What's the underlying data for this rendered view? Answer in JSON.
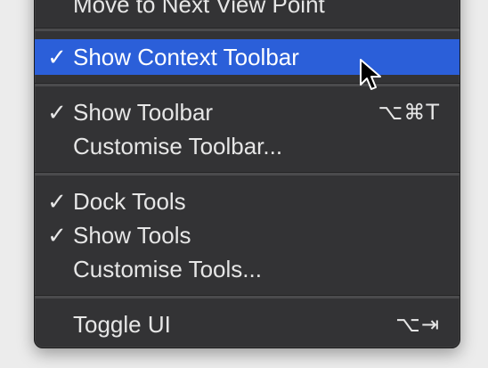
{
  "menu": {
    "items": [
      {
        "label": "Move to Next View Point",
        "checked": false,
        "shortcut": ""
      },
      {
        "label": "Show Context Toolbar",
        "checked": true,
        "shortcut": ""
      },
      {
        "label": "Show Toolbar",
        "checked": true,
        "shortcut": "⌥⌘T"
      },
      {
        "label": "Customise Toolbar...",
        "checked": false,
        "shortcut": ""
      },
      {
        "label": "Dock Tools",
        "checked": true,
        "shortcut": ""
      },
      {
        "label": "Show Tools",
        "checked": true,
        "shortcut": ""
      },
      {
        "label": "Customise Tools...",
        "checked": false,
        "shortcut": ""
      },
      {
        "label": "Toggle UI",
        "checked": false,
        "shortcut": "⌥⇥"
      }
    ],
    "check_glyph": "✓",
    "highlight_color": "#2b5fd9",
    "background_color": "#333335",
    "text_color": "#e6e6e6"
  },
  "cursor": {
    "icon": "arrow-cursor-icon"
  }
}
